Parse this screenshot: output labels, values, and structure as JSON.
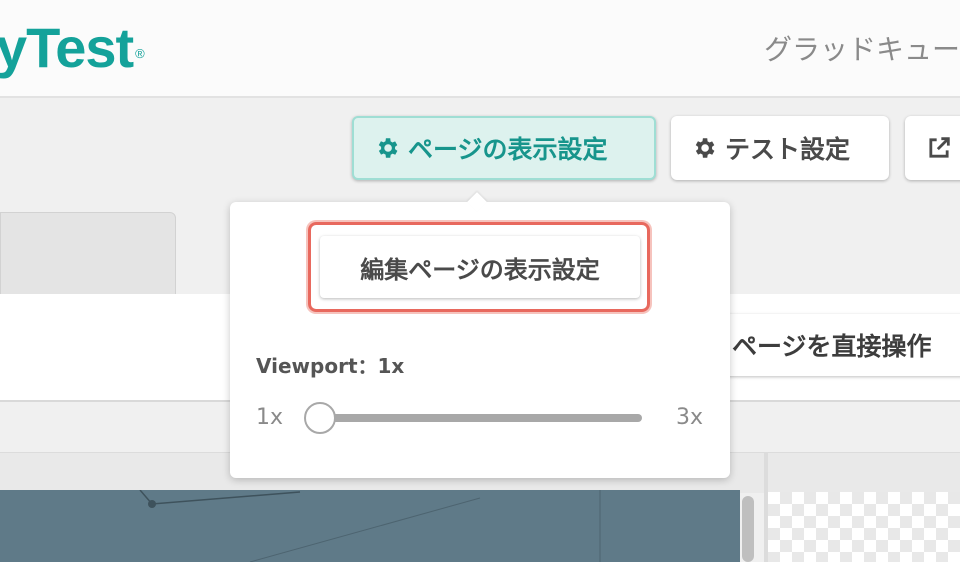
{
  "header": {
    "logo_text": "yTest",
    "logo_mark": "®",
    "right_text": "グラッドキュー"
  },
  "toolbar": {
    "page_view_settings_label": "ページの表示設定",
    "test_settings_label": "テスト設定",
    "direct_operation_label": "ページを直接操作"
  },
  "popover": {
    "edit_page_view_label": "編集ページの表示設定",
    "viewport_label": "Viewport：1x",
    "slider": {
      "min_label": "1x",
      "max_label": "3x",
      "value": 1,
      "min": 1,
      "max": 3
    }
  },
  "icons": {
    "gear": "gear-icon",
    "external": "external-link-icon"
  },
  "colors": {
    "brand": "#14a29a",
    "active_button_bg": "#ddf2ee",
    "highlight": "#e8695e"
  }
}
